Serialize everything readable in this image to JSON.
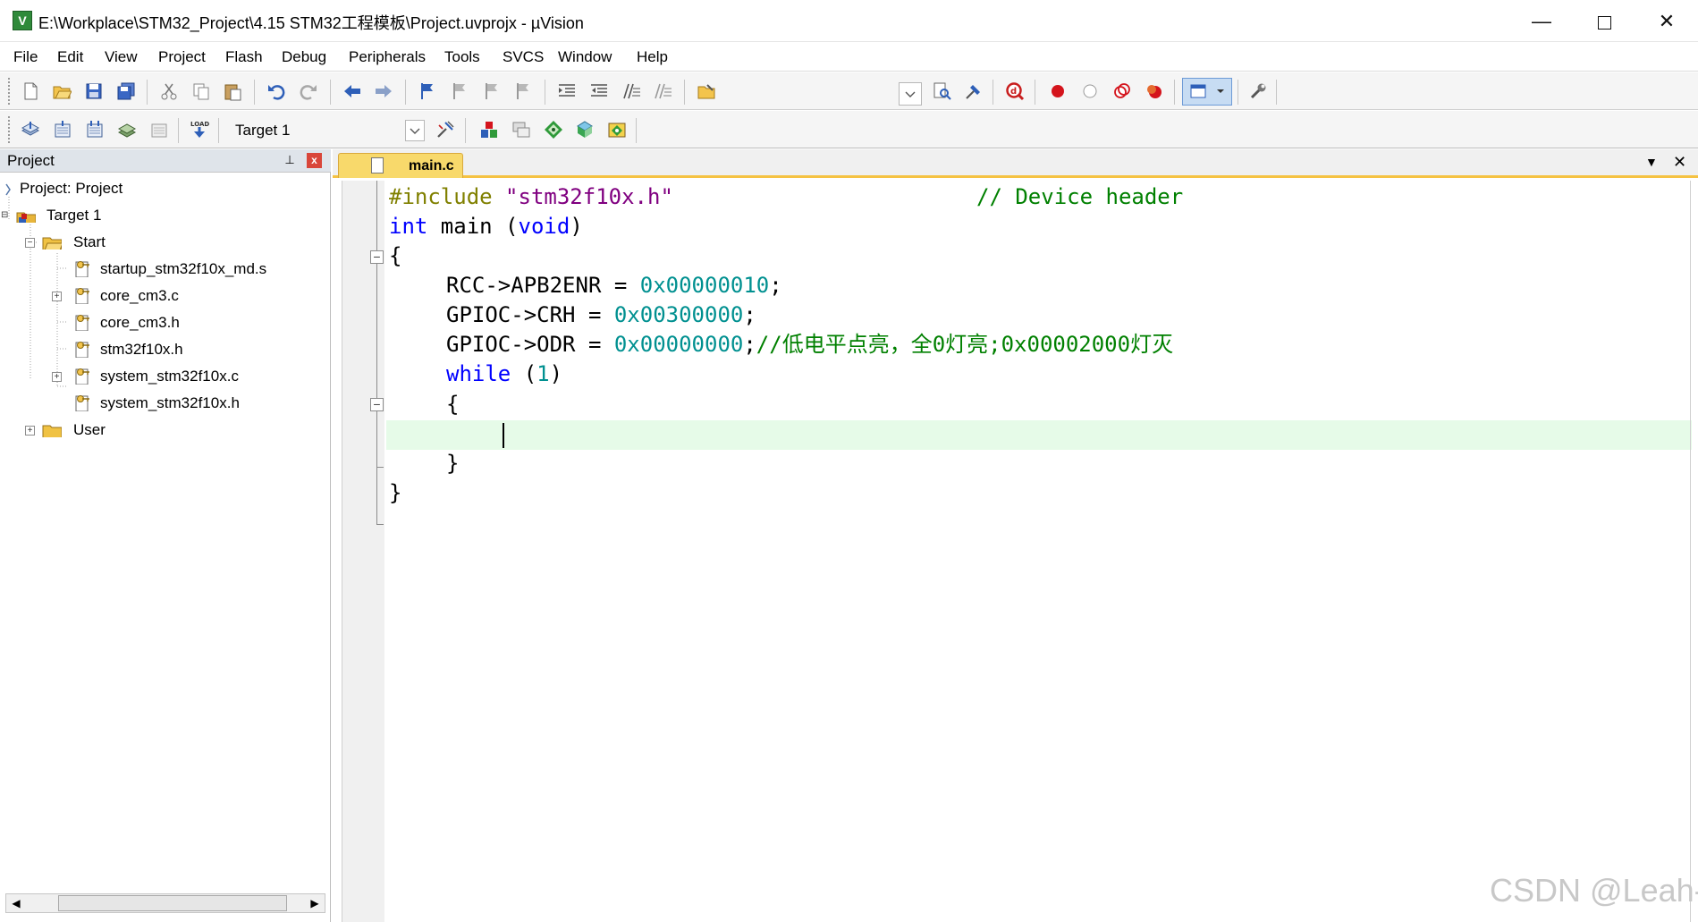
{
  "window": {
    "title": "E:\\Workplace\\STM32_Project\\4.15 STM32工程模板\\Project.uvprojx - µVision",
    "app_icon_letter": "V",
    "minimize": "—",
    "close": "✕"
  },
  "menu": [
    "File",
    "Edit",
    "View",
    "Project",
    "Flash",
    "Debug",
    "Peripherals",
    "Tools",
    "SVCS",
    "Window",
    "Help"
  ],
  "toolbar": {
    "target_name": "Target 1"
  },
  "project_panel": {
    "header": "Project",
    "pin": "⊥",
    "close": "x",
    "root": "Project: Project",
    "target": "Target 1",
    "groups": [
      {
        "name": "Start",
        "files": [
          "startup_stm32f10x_md.s",
          "core_cm3.c",
          "core_cm3.h",
          "stm32f10x.h",
          "system_stm32f10x.c",
          "system_stm32f10x.h"
        ]
      },
      {
        "name": "User"
      }
    ]
  },
  "editor": {
    "tab": "main.c",
    "code": {
      "l1_pp": "#include ",
      "l1_str": "\"stm32f10x.h\"",
      "l1_cmt": "// Device header",
      "l2_kw1": "int",
      "l2_mid": " main (",
      "l2_kw2": "void",
      "l2_end": ")",
      "l3": "{",
      "l4_code": "RCC->APB2ENR = ",
      "l4_num": "0x00000010",
      "l4_end": ";",
      "l5_code": "GPIOC->CRH = ",
      "l5_num": "0x00300000",
      "l5_end": ";",
      "l6_code": "GPIOC->ODR = ",
      "l6_num": "0x00000000",
      "l6_semi": ";",
      "l6_cmt": "//低电平点亮，全0灯亮;0x00002000灯灭",
      "l7_kw": "while",
      "l7_open": " (",
      "l7_num": "1",
      "l7_close": ")",
      "l8": "{",
      "l10": "}",
      "l11": "}"
    }
  },
  "watermark": "CSDN @Leah-",
  "colors": {
    "keyword": "#0000ff",
    "number": "#009090",
    "comment": "#008000",
    "preprocessor": "#808000",
    "string": "#800080",
    "current_line": "#e6fbe8",
    "tab_active": "#f8d96b"
  }
}
